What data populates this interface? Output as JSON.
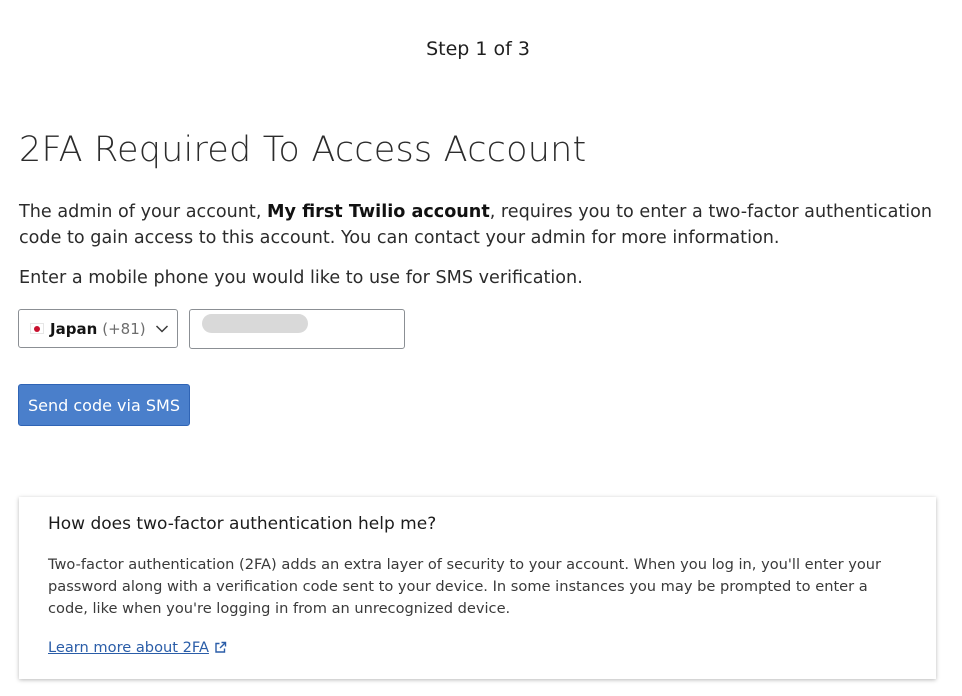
{
  "header": {
    "step": "Step 1 of 3"
  },
  "main": {
    "title": "2FA Required To Access Account",
    "description_prefix": "The admin of your account, ",
    "account_name": "My first Twilio account",
    "description_suffix": ", requires you to enter a two-factor authentication code to gain access to this account. You can contact your admin for more information.",
    "phone_prompt": "Enter a mobile phone you would like to use for SMS verification.",
    "country": {
      "flag_icon": "japan-flag-icon",
      "name": "Japan",
      "code": "(+81)",
      "chevron_icon": "chevron-down-icon"
    },
    "phone_input": {
      "value": "",
      "placeholder": ""
    },
    "send_button_label": "Send code via SMS"
  },
  "help": {
    "title": "How does two-factor authentication help me?",
    "body": "Two-factor authentication (2FA) adds an extra layer of security to your account. When you log in, you'll enter your password along with a verification code sent to your device. In some instances you may be prompted to enter a code, like when you're logging in from an unrecognized device.",
    "link_label": "Learn more about 2FA",
    "link_icon": "external-link-icon"
  },
  "colors": {
    "primary_button": "#4a7fcb",
    "link": "#2a5da8",
    "flag_red": "#c8102e"
  }
}
